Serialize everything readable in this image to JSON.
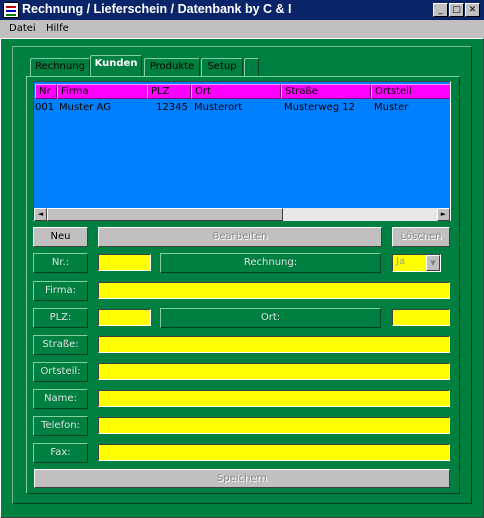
{
  "window": {
    "title": "Rechnung / Lieferschein / Datenbank by C & I",
    "minimize": "_",
    "maximize": "□",
    "close": "✕"
  },
  "menu": [
    "Datei",
    "Hilfe"
  ],
  "tabs": [
    {
      "label": "Rechnung",
      "active": false
    },
    {
      "label": "Kunden",
      "active": true
    },
    {
      "label": "Produkte",
      "active": false
    },
    {
      "label": "Setup",
      "active": false
    },
    {
      "label": "",
      "active": false
    }
  ],
  "table": {
    "columns": [
      "Nr",
      "Firma",
      "PLZ",
      "Ort",
      "Straße",
      "Ortsteil"
    ],
    "rows": [
      [
        "001",
        "Muster AG",
        "12345",
        "Musterort",
        "Musterweg 12",
        "Muster"
      ]
    ]
  },
  "scroll": {
    "left_arrow": "◄",
    "right_arrow": "►"
  },
  "buttons": {
    "neu": "Neu",
    "bearbeiten": "Bearbeiten",
    "loeschen": "Löschen",
    "speichern": "Speichern"
  },
  "form": {
    "labels": {
      "nr": "Nr.:",
      "firma": "Firma:",
      "plz": "PLZ:",
      "strasse": "Straße:",
      "ortsteil": "Ortsteil:",
      "name": "Name:",
      "telefon": "Telefon:",
      "fax": "Fax:"
    },
    "rechnung_label": "Rechnung:",
    "ort_label": "Ort:",
    "rechnung_select": "Ja",
    "dropdown_arrow": "▼",
    "values": {
      "nr": "",
      "firma": "",
      "plz": "",
      "ort": "",
      "strasse": "",
      "ortsteil": "",
      "name": "",
      "telefon": "",
      "fax": ""
    }
  },
  "colors": {
    "background": "#008040",
    "table": "#0080ff",
    "header": "#ff00ff",
    "input": "#ffff00"
  }
}
